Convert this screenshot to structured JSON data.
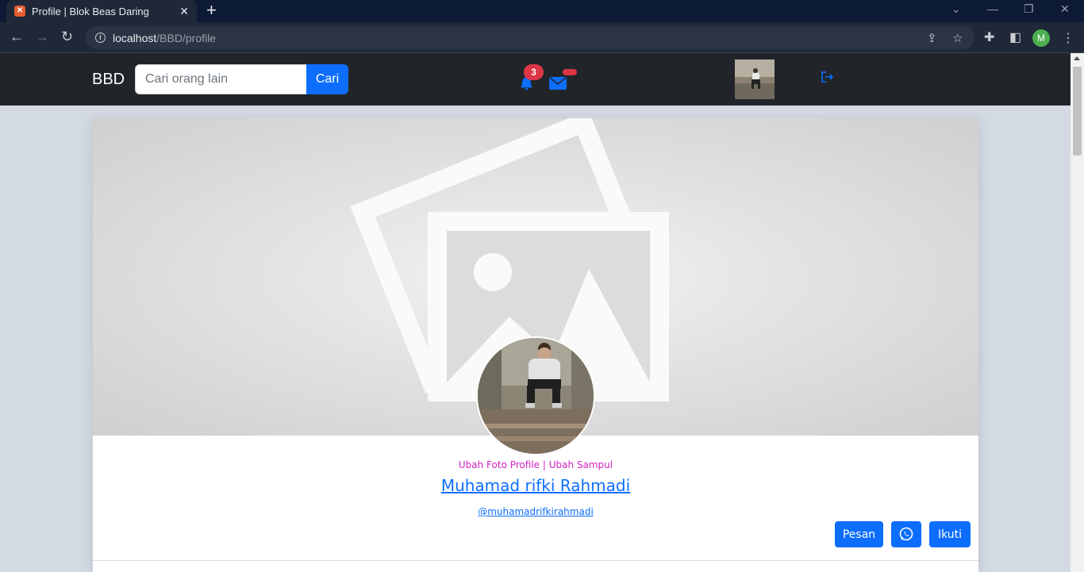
{
  "browser": {
    "tab_title": "Profile | Blok Beas Daring",
    "url_host": "localhost",
    "url_path": "/BBD/profile",
    "profile_initial": "M"
  },
  "navbar": {
    "brand": "BBD",
    "search_placeholder": "Cari orang lain",
    "search_button": "Cari",
    "notification_count": "3",
    "icons": [
      "bell-icon",
      "envelope-icon",
      "logout-icon"
    ]
  },
  "profile": {
    "edit_photo": "Ubah Foto Profile",
    "separator": " | ",
    "edit_cover": "Ubah Sampul",
    "full_name": "Muhamad rifki Rahmadi",
    "username": "@muhamadrifkirahmadi",
    "buttons": {
      "message": "Pesan",
      "follow": "Ikuti"
    }
  },
  "colors": {
    "primary": "#0d6efd",
    "navbar_bg": "#212529",
    "badge": "#dc3545",
    "edit_link": "#d021c2"
  }
}
